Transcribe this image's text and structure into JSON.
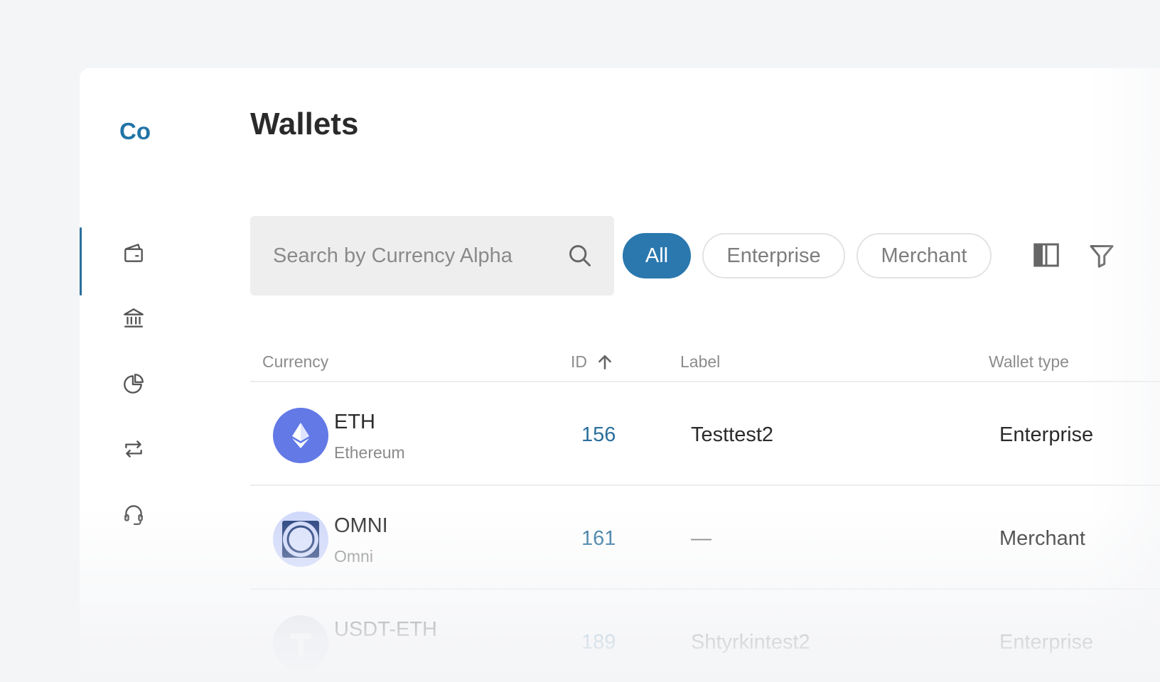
{
  "app": {
    "logo_text": "Co"
  },
  "sidebar": {
    "items": [
      {
        "icon": "wallet-icon",
        "active": true
      },
      {
        "icon": "bank-icon",
        "active": false
      },
      {
        "icon": "pie-chart-icon",
        "active": false
      },
      {
        "icon": "exchange-arrows-icon",
        "active": false
      },
      {
        "icon": "headset-icon",
        "active": false
      }
    ]
  },
  "main": {
    "title": "Wallets",
    "search": {
      "placeholder": "Search by Currency Alpha",
      "value": ""
    },
    "filters": [
      {
        "label": "All",
        "active": true
      },
      {
        "label": "Enterprise",
        "active": false
      },
      {
        "label": "Merchant",
        "active": false
      }
    ],
    "tools": {
      "columns_icon": "columns-icon",
      "filter_icon": "filter-icon"
    }
  },
  "table": {
    "columns": {
      "currency": "Currency",
      "id": "ID",
      "label": "Label",
      "wallet_type": "Wallet type"
    },
    "sort": {
      "column": "id",
      "direction": "ascending"
    },
    "rows": [
      {
        "code": "ETH",
        "name": "Ethereum",
        "id": "156",
        "label": "Testtest2",
        "wallet_type": "Enterprise",
        "icon": "ethereum-icon"
      },
      {
        "code": "OMNI",
        "name": "Omni",
        "id": "161",
        "label": "—",
        "wallet_type": "Merchant",
        "icon": "omni-icon"
      },
      {
        "code": "USDT-ETH",
        "name": "",
        "id": "189",
        "label": "Shtyrkintest2",
        "wallet_type": "Enterprise",
        "icon": "tether-icon"
      }
    ]
  },
  "colors": {
    "accent": "#2a78ae",
    "link": "#2a6f9c",
    "eth": "#6279e6",
    "omni_bg": "#cfd8fb",
    "omni_ring": "#1e3a78"
  }
}
